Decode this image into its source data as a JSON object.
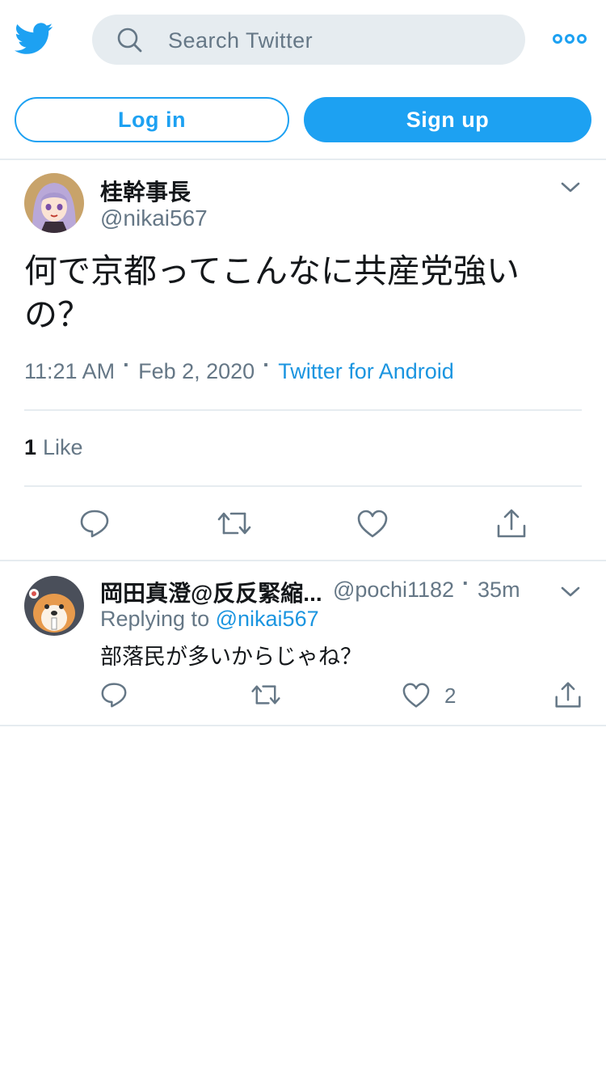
{
  "header": {
    "search_placeholder": "Search Twitter",
    "login_label": "Log in",
    "signup_label": "Sign up"
  },
  "tweet": {
    "display_name": "桂幹事長",
    "handle": "@nikai567",
    "text": "何で京都ってこんなに共産党強いの？",
    "time": "11:21 AM",
    "date": "Feb 2, 2020",
    "source": "Twitter for Android",
    "like_count": "1",
    "like_label": "Like"
  },
  "reply": {
    "display_name": "岡田真澄@反反緊縮...",
    "handle": "@pochi1182",
    "age": "35m",
    "replying_to_label": "Replying to",
    "replying_to_handle": "@nikai567",
    "text": "部落民が多いからじゃね？",
    "like_count": "2"
  },
  "colors": {
    "brand": "#1da1f2",
    "link": "#1b95e0",
    "secondary_text": "#657786",
    "divider": "#e6ecf0"
  }
}
